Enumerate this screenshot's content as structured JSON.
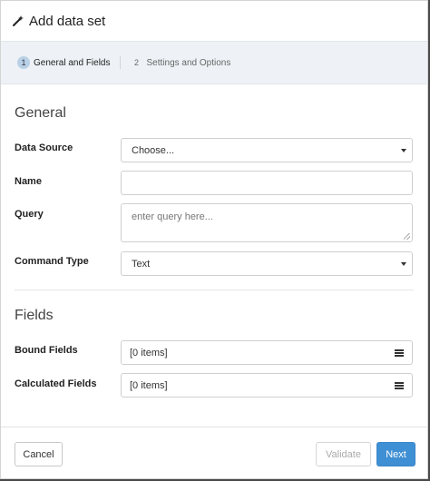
{
  "dialog": {
    "title": "Add data set",
    "title_icon": "magic-wand-icon"
  },
  "steps": [
    {
      "number": "1",
      "label": "General and Fields",
      "active": true
    },
    {
      "number": "2",
      "label": "Settings and Options",
      "active": false
    }
  ],
  "general": {
    "heading": "General",
    "data_source": {
      "label": "Data Source",
      "value": "Choose..."
    },
    "name": {
      "label": "Name",
      "value": ""
    },
    "query": {
      "label": "Query",
      "placeholder": "enter query here..."
    },
    "command_type": {
      "label": "Command Type",
      "value": "Text"
    }
  },
  "fields": {
    "heading": "Fields",
    "bound_fields": {
      "label": "Bound Fields",
      "value": "[0 items]"
    },
    "calculated_fields": {
      "label": "Calculated Fields",
      "value": "[0 items]"
    }
  },
  "footer": {
    "cancel_label": "Cancel",
    "validate_label": "Validate",
    "next_label": "Next"
  },
  "colors": {
    "primary": "#3f8fd4",
    "step_bar_bg": "#eef2f6",
    "active_step_badge": "#b9d1e6"
  }
}
